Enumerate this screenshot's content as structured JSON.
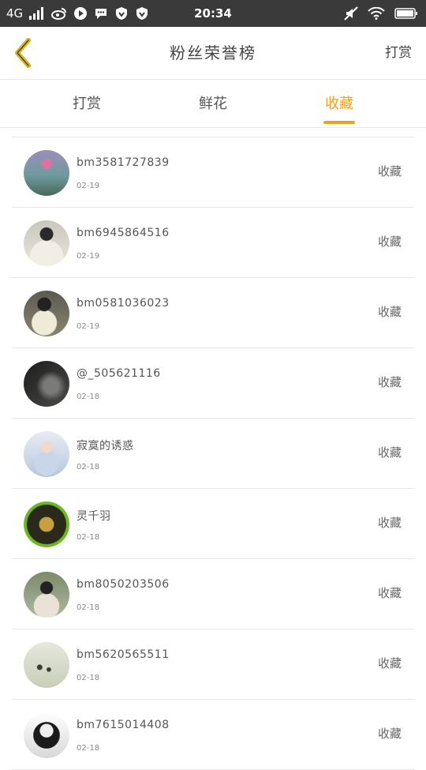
{
  "status_bar": {
    "network": "4G",
    "time": "20:34",
    "left_icons": [
      "signal-icon",
      "weibo-icon",
      "play-icon",
      "chat-icon",
      "vpn-shield-icon",
      "vpn-shield-icon-2"
    ],
    "right_icons": [
      "mute-icon",
      "wifi-icon",
      "battery-icon"
    ]
  },
  "nav": {
    "title": "粉丝荣誉榜",
    "right_label": "打赏"
  },
  "tabs": [
    {
      "label": "打赏",
      "active": false
    },
    {
      "label": "鲜花",
      "active": false
    },
    {
      "label": "收藏",
      "active": true
    }
  ],
  "accent_color": "#f0a020",
  "rows": [
    {
      "name": "bm3581727839",
      "date": "02-19",
      "action": "收藏",
      "avatar": "flowers-avatar"
    },
    {
      "name": "bm6945864516",
      "date": "02-19",
      "action": "收藏",
      "avatar": "person-avatar"
    },
    {
      "name": "bm0581036023",
      "date": "02-19",
      "action": "收藏",
      "avatar": "person-avatar"
    },
    {
      "name": "@_505621116",
      "date": "02-18",
      "action": "收藏",
      "avatar": "dark-avatar"
    },
    {
      "name": "寂寞的诱惑",
      "date": "02-18",
      "action": "收藏",
      "avatar": "anime-avatar"
    },
    {
      "name": "灵千羽",
      "date": "02-18",
      "action": "收藏",
      "avatar": "game-avatar"
    },
    {
      "name": "bm8050203506",
      "date": "02-18",
      "action": "收藏",
      "avatar": "person-avatar"
    },
    {
      "name": "bm5620565511",
      "date": "02-18",
      "action": "收藏",
      "avatar": "dandelion-avatar"
    },
    {
      "name": "bm7615014408",
      "date": "02-18",
      "action": "收藏",
      "avatar": "cartoon-avatar"
    }
  ]
}
